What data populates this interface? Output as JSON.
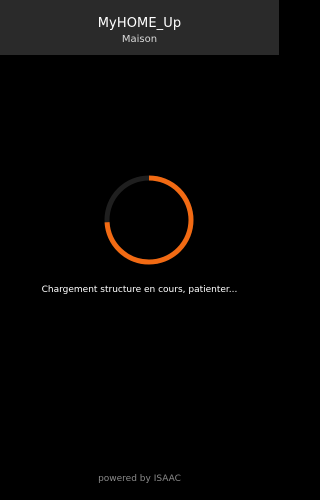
{
  "header": {
    "title": "MyHOME_Up",
    "subtitle": "Maison"
  },
  "loading": {
    "message": "Chargement structure en cours, patienter...",
    "progress": 0.74
  },
  "footer": {
    "text": "powered by ISAAC"
  },
  "icons": {
    "spinner": "loading-spinner-icon"
  },
  "colors": {
    "background": "#000000",
    "header_background": "#2a2a2a",
    "spinner_track": "#1f1f1f",
    "spinner_arc": "#f26a13"
  }
}
